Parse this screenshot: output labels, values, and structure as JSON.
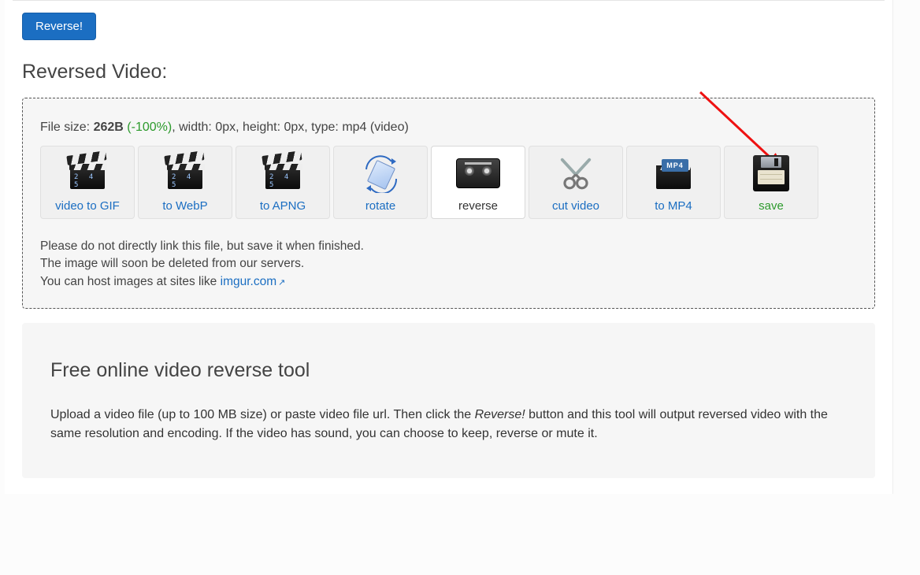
{
  "reverse_button": "Reverse!",
  "section_title": "Reversed Video:",
  "file_info": {
    "prefix": "File size: ",
    "size": "262B",
    "pct": "(-100%)",
    "rest": ", width: 0px, height: 0px, type: mp4 (video)"
  },
  "tools": {
    "gif": {
      "label": "video to GIF"
    },
    "webp": {
      "label": "to WebP"
    },
    "apng": {
      "label": "to APNG"
    },
    "rotate": {
      "label": "rotate"
    },
    "reverse": {
      "label": "reverse"
    },
    "cut": {
      "label": "cut video"
    },
    "mp4": {
      "label": "to MP4"
    },
    "save": {
      "label": "save"
    }
  },
  "notes": {
    "l1": "Please do not directly link this file, but save it when finished.",
    "l2": "The image will soon be deleted from our servers.",
    "l3a": "You can host images at sites like ",
    "link": "imgur.com"
  },
  "desc": {
    "title": "Free online video reverse tool",
    "p1a": "Upload a video file (up to 100 MB size) or paste video file url. Then click the ",
    "em": "Reverse!",
    "p1b": " button and this tool will output reversed video with the same resolution and encoding. If the video has sound, you can choose to keep, reverse or mute it."
  },
  "clapper_nums": "2 4 5",
  "mp4_tag": "MP4"
}
